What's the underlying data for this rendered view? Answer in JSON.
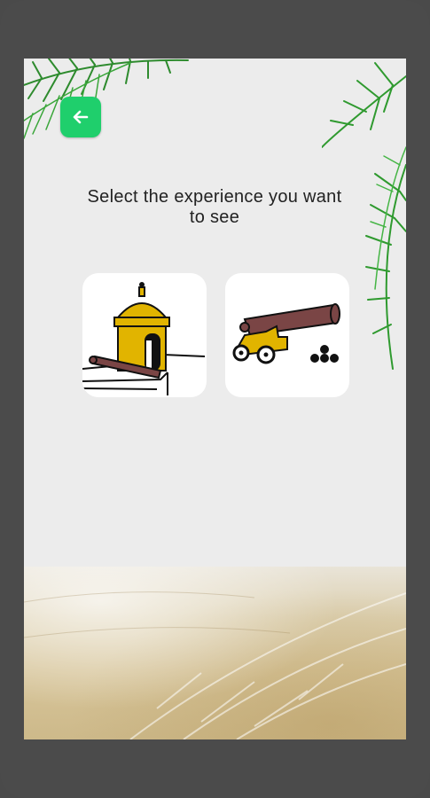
{
  "header": {
    "back_icon": "arrow-left-icon",
    "title": "Select the experience you want to see"
  },
  "experiences": [
    {
      "id": "sentry-box",
      "icon": "sentry-box-icon"
    },
    {
      "id": "cannon",
      "icon": "cannon-icon"
    }
  ],
  "colors": {
    "frame": "#4b4b4b",
    "screen_bg": "#ececec",
    "accent_green": "#1fcf6c",
    "gold": "#e1b400",
    "cannon_brown": "#7a4545"
  }
}
